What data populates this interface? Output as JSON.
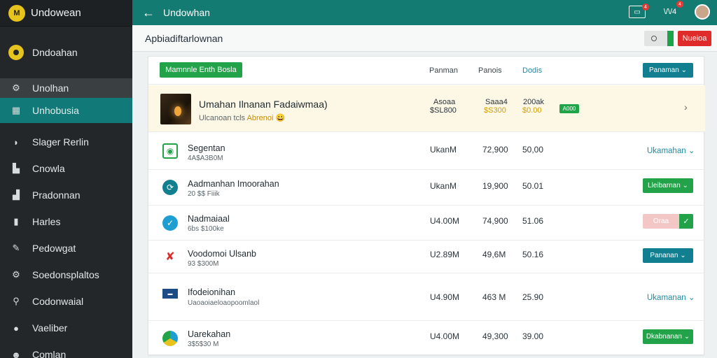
{
  "sidebar": {
    "brand": {
      "logo_text": "M",
      "name": "Undowean"
    },
    "group": {
      "label": "Dndoahan"
    },
    "items": [
      {
        "label": "Unolhan",
        "icon": "settings-icon",
        "state": "hover"
      },
      {
        "label": "Unhobusia",
        "icon": "grid-icon",
        "state": "active"
      },
      {
        "label": "Slager Rerlin",
        "icon": "chat-icon"
      },
      {
        "label": "Cnowla",
        "icon": "home-icon"
      },
      {
        "label": "Pradonnan",
        "icon": "building-icon"
      },
      {
        "label": "Harles",
        "icon": "chart-icon"
      },
      {
        "label": "Pedowgat",
        "icon": "edit-icon"
      },
      {
        "label": "Soedonsplaltos",
        "icon": "settings-icon"
      },
      {
        "label": "Codonwaial",
        "icon": "search-icon"
      },
      {
        "label": "Vaeliber",
        "icon": "location-icon"
      },
      {
        "label": "Comlan",
        "icon": "user-icon"
      }
    ]
  },
  "topbar": {
    "title": "Undowhan",
    "notif_badge": "4",
    "wallet_label": "\\/\\/4",
    "wallet_badge": "4"
  },
  "subheader": {
    "breadcrumb": "Apbiadiftarlownan",
    "toggle_text": "O",
    "action_button": "Nueioa"
  },
  "card": {
    "primary_button": "Mamnnle Enth Bosla",
    "col1": "Panman",
    "col2": "Panois",
    "col3": "Dodis",
    "filter_button": "Panaman"
  },
  "rows": [
    {
      "name": "Umahan Ilnanan Fadaiwmaa)",
      "sub": "Ulcanoan tcls",
      "sub_highlight": "Abrenoi",
      "c1a": "Asoaa",
      "c1b": "$SL800",
      "c2a": "Saaa4",
      "c2b": "$S300",
      "c3a": "200ak",
      "c3b": "$0.00",
      "chip": "A000"
    },
    {
      "name": "Segentan",
      "sub": "4A$A3B0M",
      "c1": "UkanM",
      "c2": "72,900",
      "c3": "50,00",
      "action": "Ukamahan"
    },
    {
      "name": "Aadmanhan Imoorahan",
      "sub": "20 $$ Fiiik",
      "c1": "UkanM",
      "c2": "19,900",
      "c3": "50.01",
      "action": "Lleibarnan"
    },
    {
      "name": "Nadmaiaal",
      "sub": "6bs $100ke",
      "c1": "U4.00M",
      "c2": "74,900",
      "c3": "51.06",
      "action": "Oraa"
    },
    {
      "name": "Voodomoi Ulsanb",
      "sub": "93 $300M",
      "c1": "U2.89M",
      "c2": "49,6M",
      "c3": "50.16",
      "action": "Pananan"
    },
    {
      "name": "Ifodeionihan",
      "sub": "Uaoaoiaeloaopoomlaol",
      "c1": "U4.90M",
      "c2": "463 M",
      "c3": "25.90",
      "action": "Ukamanan"
    },
    {
      "name": "Uarekahan",
      "sub": "3$5$30 M",
      "c1": "U4.00M",
      "c2": "49,300",
      "c3": "39.00",
      "action": "Dkabnanan"
    }
  ],
  "colors": {
    "accent": "#147b72",
    "active": "#117a78",
    "green": "#22a34a",
    "red": "#e02b2b",
    "teal_button": "#117f90"
  }
}
